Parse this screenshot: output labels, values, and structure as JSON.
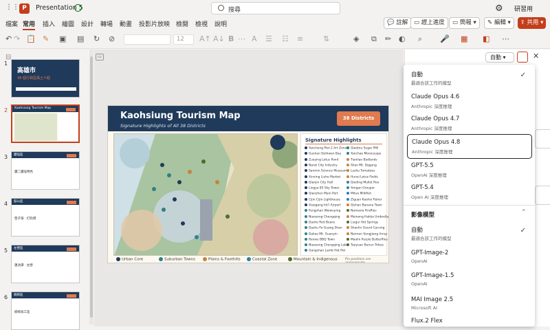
{
  "titlebar": {
    "app_logo": "P",
    "doc_title": "Presentation 5",
    "search_placeholder": "搜尋",
    "user_name": "研習用"
  },
  "menu": {
    "tabs": [
      "檔案",
      "常用",
      "插入",
      "繪圖",
      "設計",
      "轉場",
      "動畫",
      "投影片放映",
      "檢閱",
      "檢視",
      "說明"
    ],
    "active": "常用",
    "comments": "註解",
    "catch_up": "趕上進度",
    "present": "簡報",
    "editing": "編輯",
    "share": "共用"
  },
  "toolbar": {
    "font_size": "12"
  },
  "thumbnails": [
    {
      "num": "1",
      "title": "高雄市",
      "body": "38 個行政區風土介紹"
    },
    {
      "num": "2",
      "title": "Kaohsiung Tourism Map",
      "body": ""
    },
    {
      "num": "3",
      "title": "鹽埕區",
      "body": "鹽二鹽埕特色"
    },
    {
      "num": "4",
      "title": "鼓山區",
      "body": "西子灣 · 打狗港"
    },
    {
      "num": "5",
      "title": "左營區",
      "body": "蓮池潭 · 左營"
    },
    {
      "num": "6",
      "title": "楠梓區",
      "body": "楠梓加工區"
    }
  ],
  "slide": {
    "title": "Kaohsiung Tourism Map",
    "subtitle": "Signature Highlights of All 38 Districts",
    "badge": "38 Districts",
    "highlights_title": "Signature Highlights",
    "highlights_col1": [
      {
        "name": "Yancheng Pier-2 Art Zone",
        "color": "#1f3a5a"
      },
      {
        "name": "Gushan Sizihwan Bay",
        "color": "#1f3a5a"
      },
      {
        "name": "Zuoying Lotus Pond",
        "color": "#1f3a5a"
      },
      {
        "name": "Nanzi City Industry",
        "color": "#1f3a5a"
      },
      {
        "name": "Sanmin Science Museum",
        "color": "#1f3a5a"
      },
      {
        "name": "Xinxing Liuhe Market",
        "color": "#1f3a5a"
      },
      {
        "name": "Qianjin City Hall",
        "color": "#1f3a5a"
      },
      {
        "name": "Lingya 85 Sky Tower",
        "color": "#1f3a5a"
      },
      {
        "name": "Qianzhen Main Port",
        "color": "#1f3a5a"
      },
      {
        "name": "Cijin Cijin Lighthouse",
        "color": "#1f3a5a"
      },
      {
        "name": "Xiaogang Int'l Airport",
        "color": "#1f3a5a"
      },
      {
        "name": "Fengshan Weiwuying",
        "color": "#2f7f86"
      },
      {
        "name": "Niaosong Chengqing",
        "color": "#2f7f86"
      },
      {
        "name": "Dashe Red Beans",
        "color": "#2f7f86"
      },
      {
        "name": "Dashu Fo Guang Shan",
        "color": "#2f7f86"
      },
      {
        "name": "Daliao Mt. Guanyin",
        "color": "#2f7f86"
      },
      {
        "name": "Renwu BBQ Town",
        "color": "#2f7f86"
      },
      {
        "name": "Niaosong Chengqing Lake",
        "color": "#2f7f86"
      },
      {
        "name": "Gangshan Lamb Hot Pot",
        "color": "#2f7f86"
      }
    ],
    "highlights_col2": [
      {
        "name": "Qiaotou Sugar Mill",
        "color": "#2f7f86"
      },
      {
        "name": "Yanchao Moonscape",
        "color": "#2f7f86"
      },
      {
        "name": "Tianliao Badlands",
        "color": "#c9823c"
      },
      {
        "name": "Alian Mt. Dagang",
        "color": "#c9823c"
      },
      {
        "name": "Luzhu Tomatoes",
        "color": "#c9823c"
      },
      {
        "name": "Hunei Lotus Fields",
        "color": "#c9823c"
      },
      {
        "name": "Qieding Mullet Roe",
        "color": "#2e7fa8"
      },
      {
        "name": "Yongan Grouper",
        "color": "#2e7fa8"
      },
      {
        "name": "Mituo Milkfish",
        "color": "#2e7fa8"
      },
      {
        "name": "Ziguan Kaohsi Fisher",
        "color": "#2e7fa8"
      },
      {
        "name": "Qishan Banana Town",
        "color": "#c9823c"
      },
      {
        "name": "Namaxia Fireflies",
        "color": "#4f6b2e"
      },
      {
        "name": "Meinong Hakka Umbrellas",
        "color": "#c9823c"
      },
      {
        "name": "Liugui Hot Springs",
        "color": "#4f6b2e"
      },
      {
        "name": "Shanlin Gourd Carving",
        "color": "#c9823c"
      },
      {
        "name": "Neimen Songjiang Array",
        "color": "#c9823c"
      },
      {
        "name": "Maolin Purple Butterflies",
        "color": "#4f6b2e"
      },
      {
        "name": "Taoyuan Bunun Tribes",
        "color": "#4f6b2e"
      }
    ],
    "legend": [
      {
        "label": "Urban Core",
        "color": "#1f3a5a"
      },
      {
        "label": "Suburban Towns",
        "color": "#2f7f86"
      },
      {
        "label": "Plains & Foothills",
        "color": "#c9823c"
      },
      {
        "label": "Coastal Zone",
        "color": "#2e7fa8"
      },
      {
        "label": "Mountain & Indigenous",
        "color": "#4f6b2e"
      }
    ],
    "legend_note": "Pin positions are approximate"
  },
  "panel": {
    "picker_label": "自動",
    "text_models": [
      {
        "name": "自動",
        "desc": "最適合該工作的模型",
        "checked": true
      },
      {
        "name": "Claude Opus 4.6",
        "desc": "Anthropic 深度推理"
      },
      {
        "name": "Claude Opus 4.7",
        "desc": "Anthropic 深度推理"
      },
      {
        "name": "Claude Opus 4.8",
        "desc": "Anthropic 深度推理",
        "selected": true
      },
      {
        "name": "GPT-5.5",
        "desc": "OpenAI 深度推理"
      },
      {
        "name": "GPT-5.4",
        "desc": "Open AI 深度推理"
      }
    ],
    "image_section_title": "影像模型",
    "image_models": [
      {
        "name": "自動",
        "desc": "最適合該工作的模型",
        "checked": true
      },
      {
        "name": "GPT-Image-2",
        "desc": "OpenAI"
      },
      {
        "name": "GPT-Image-1.5",
        "desc": "OpenAI"
      },
      {
        "name": "MAI Image 2.5",
        "desc": "Microsoft AI"
      },
      {
        "name": "Flux.2 Flex",
        "desc": ""
      }
    ]
  }
}
